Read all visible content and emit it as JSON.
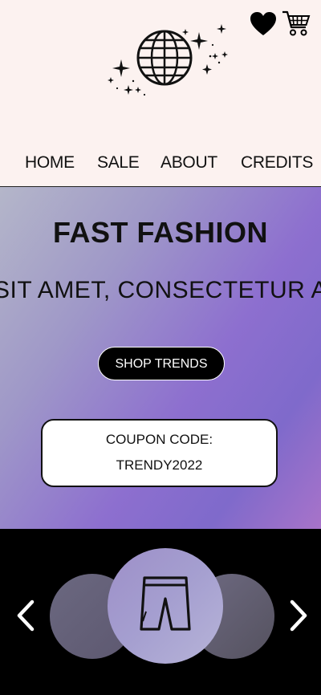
{
  "header": {
    "icons": [
      "heart-icon",
      "shopping-cart-icon",
      "disco-globe-logo-icon"
    ]
  },
  "nav": {
    "items": [
      "HOME",
      "SALE",
      "ABOUT",
      "CREDITS"
    ]
  },
  "hero": {
    "title": "FAST FASHION",
    "marquee": "SIT AMET, CONSECTETUR AD",
    "shop_button": "SHOP TRENDS",
    "coupon_label": "COUPON CODE:",
    "coupon_code": "TRENDY2022"
  },
  "carousel": {
    "icons": [
      "chevron-left-icon",
      "shorts-icon",
      "chevron-right-icon"
    ]
  },
  "colors": {
    "header_bg": "#fcf2f0",
    "hero_gradient_start": "#b4b6c9",
    "hero_gradient_mid": "#8d6fcf",
    "hero_gradient_end": "#a873c9",
    "carousel_bg": "#000000"
  }
}
